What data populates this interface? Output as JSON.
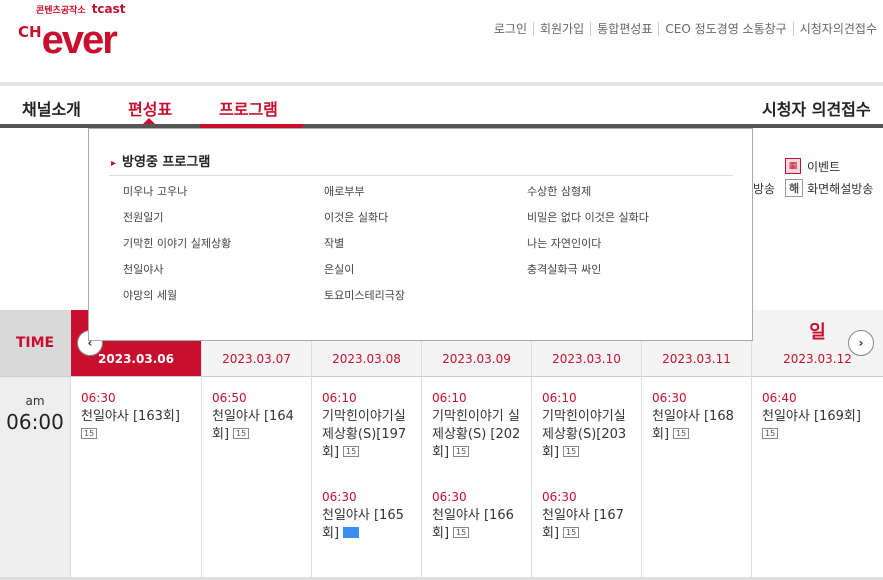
{
  "header": {
    "logo_sub": "콘텐츠공작소",
    "logo_tcast": "tcast",
    "logo_ch": "CH",
    "logo_ever": "ever",
    "util_links": [
      "로그인",
      "회원가입",
      "통합편성표",
      "CEO 정도경영 소통창구",
      "시청자의견접수"
    ]
  },
  "gnb": {
    "items": [
      "채널소개",
      "편성표",
      "프로그램"
    ],
    "right": "시청자 의견접수"
  },
  "side_links": {
    "event": "이벤트",
    "broadcast_fragment": "방송",
    "hae_icon": "해",
    "screen_commentary": "화면해설방송"
  },
  "dropdown": {
    "title": "방영중 프로그램",
    "col1": [
      "미우나 고우나",
      "전원일기",
      "기막힌 이야기 실제상황",
      "천일야사",
      "야망의 세월"
    ],
    "col2": [
      "애로부부",
      "이것은 실화다",
      "작별",
      "은실이",
      "토요미스테리극장"
    ],
    "col3": [
      "수상한 삼형제",
      "비밀은 없다 이것은 실화다",
      "나는 자연인이다",
      "충격실화극 싸인"
    ]
  },
  "schedule": {
    "time_label": "TIME",
    "weekday_sun": "일",
    "dates": [
      "2023.03.06",
      "2023.03.07",
      "2023.03.08",
      "2023.03.09",
      "2023.03.10",
      "2023.03.11",
      "2023.03.12"
    ],
    "am": "am",
    "hour": "06:00",
    "prev_icon": "‹",
    "next_icon": "›",
    "rating": "15",
    "programs": {
      "d0": [
        {
          "time": "06:30",
          "title": "천일야사 [163회]"
        }
      ],
      "d1": [
        {
          "time": "06:50",
          "title": "천일야사 [164회]"
        }
      ],
      "d2": [
        {
          "time": "06:10",
          "title": "기막힌이야기실제상황(S)[197회]"
        },
        {
          "time": "06:30",
          "title": "천일야사 [165회]"
        }
      ],
      "d3": [
        {
          "time": "06:10",
          "title": "기막힌이야기 실제상황(S) [202회]"
        },
        {
          "time": "06:30",
          "title": "천일야사 [166회]"
        }
      ],
      "d4": [
        {
          "time": "06:10",
          "title": "기막힌이야기실제상황(S)[203회]"
        },
        {
          "time": "06:30",
          "title": "천일야사 [167회]"
        }
      ],
      "d5": [
        {
          "time": "06:30",
          "title": "천일야사 [168회]"
        }
      ],
      "d6": [
        {
          "time": "06:40",
          "title": "천일야사 [169회]"
        }
      ]
    }
  }
}
